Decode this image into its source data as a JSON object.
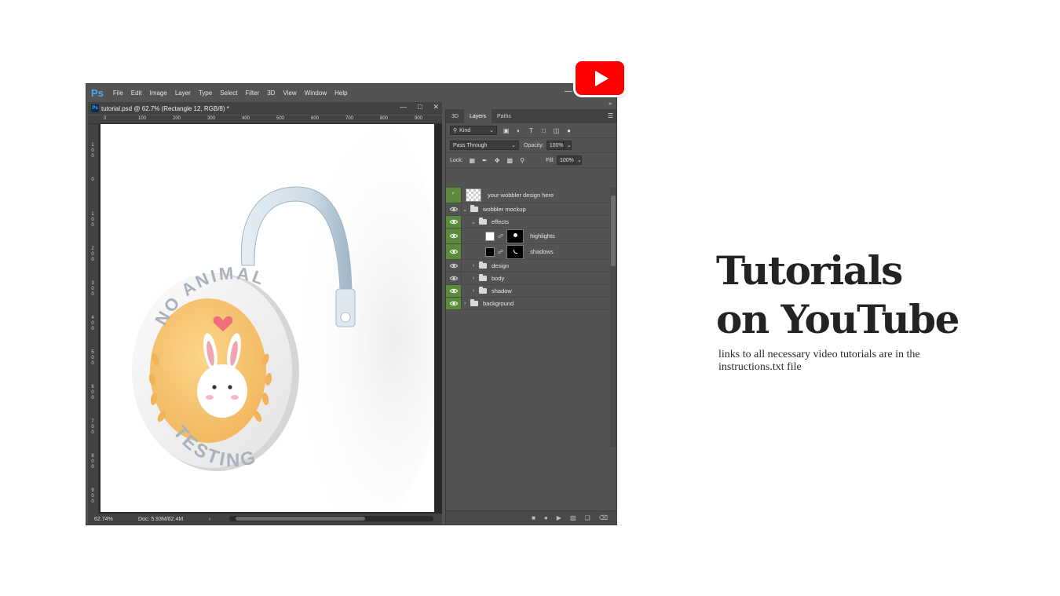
{
  "app": {
    "logo": "Ps",
    "menu": [
      "File",
      "Edit",
      "Image",
      "Layer",
      "Type",
      "Select",
      "Filter",
      "3D",
      "View",
      "Window",
      "Help"
    ]
  },
  "document": {
    "tab_title": "tutorial.psd @ 62.7% (Rectangle 12, RGB/8) *",
    "ruler_h": [
      "0",
      "100",
      "200",
      "300",
      "400",
      "500",
      "600",
      "700",
      "800",
      "900"
    ],
    "ruler_v": [
      "100",
      "0",
      "100",
      "200",
      "300",
      "400",
      "500",
      "600",
      "700",
      "800",
      "900"
    ],
    "artwork": {
      "text_top": "NO ANIMAL",
      "text_bottom": "TESTING"
    }
  },
  "status": {
    "zoom": "62.74%",
    "doc_size": "Doc: 5.93M/62.4M"
  },
  "panel": {
    "tabs": [
      "3D",
      "Layers",
      "Paths"
    ],
    "active_tab": "Layers",
    "filter_kind": "Kind",
    "blend_mode": "Pass Through",
    "opacity_label": "Opacity:",
    "opacity_value": "100%",
    "lock_label": "Lock:",
    "fill_label": "Fill:",
    "fill_value": "100%",
    "layers": [
      {
        "name": "your wobbler design here",
        "kind": "smart",
        "visible": true,
        "green": true,
        "indent": 0
      },
      {
        "name": "wobbler mockup",
        "kind": "group",
        "expanded": true,
        "visible": true,
        "green": false,
        "indent": 0
      },
      {
        "name": "effects",
        "kind": "group",
        "expanded": true,
        "visible": true,
        "green": true,
        "indent": 1
      },
      {
        "name": "highlights",
        "kind": "layer-mask",
        "thumb": "white",
        "visible": true,
        "green": true,
        "indent": 2
      },
      {
        "name": "shadows",
        "kind": "layer-mask",
        "thumb": "black",
        "visible": true,
        "green": true,
        "indent": 2
      },
      {
        "name": "design",
        "kind": "group",
        "expanded": false,
        "visible": true,
        "green": false,
        "indent": 1
      },
      {
        "name": "body",
        "kind": "group",
        "expanded": false,
        "visible": true,
        "green": false,
        "indent": 1
      },
      {
        "name": "shadow",
        "kind": "group",
        "expanded": false,
        "visible": true,
        "green": true,
        "indent": 1
      },
      {
        "name": "background",
        "kind": "group",
        "expanded": false,
        "visible": true,
        "green": true,
        "indent": 0
      }
    ]
  },
  "promo": {
    "headline_line1": "Tutorials",
    "headline_line2": "on YouTube",
    "subtext": "links to all necessary video tutorials are in the instructions.txt file"
  },
  "colors": {
    "youtube_red": "#ff0000",
    "ps_ui": "#535353",
    "visible_green": "#5b8a3c"
  }
}
